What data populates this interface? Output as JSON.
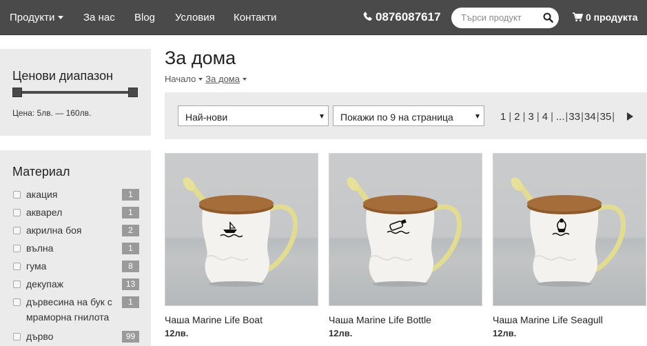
{
  "nav": {
    "products_label": "Продукти",
    "links": [
      "За нас",
      "Blog",
      "Условия",
      "Контакти"
    ],
    "phone": "0876087617",
    "search_placeholder": "Търси продукт",
    "cart_label": "0 продукта"
  },
  "sidebar": {
    "price": {
      "title": "Ценови диапазон",
      "range_text": "Цена: 5лв. — 160лв."
    },
    "material": {
      "title": "Материал",
      "items": [
        {
          "label": "акация",
          "count": "1"
        },
        {
          "label": "акварел",
          "count": "1"
        },
        {
          "label": "акрилна боя",
          "count": "2"
        },
        {
          "label": "вълна",
          "count": "1"
        },
        {
          "label": "гума",
          "count": "8"
        },
        {
          "label": "декупаж",
          "count": "13"
        },
        {
          "label": "дървесина на бук с мраморна гнилота",
          "count": "1"
        },
        {
          "label": "дърво",
          "count": "99"
        }
      ]
    }
  },
  "main": {
    "title": "За дома",
    "breadcrumb": [
      "Начало",
      "За дома"
    ],
    "sort_selected": "Най-нови",
    "per_page_selected": "Покажи по 9 на страница",
    "pagination": [
      "1",
      "2",
      "3",
      "4",
      "...",
      "33",
      "34",
      "35"
    ],
    "products": [
      {
        "name": "Чаша Marine Life Boat",
        "price": "12лв.",
        "icon": "boat-icon"
      },
      {
        "name": "Чаша Marine Life Bottle",
        "price": "12лв.",
        "icon": "bottle-icon"
      },
      {
        "name": "Чаша Marine Life Seagull",
        "price": "12лв.",
        "icon": "seagull-icon"
      }
    ]
  },
  "colors": {
    "navbar": "#4a4a4a",
    "panel": "#ebebeb",
    "badge": "#9a9a9a"
  }
}
